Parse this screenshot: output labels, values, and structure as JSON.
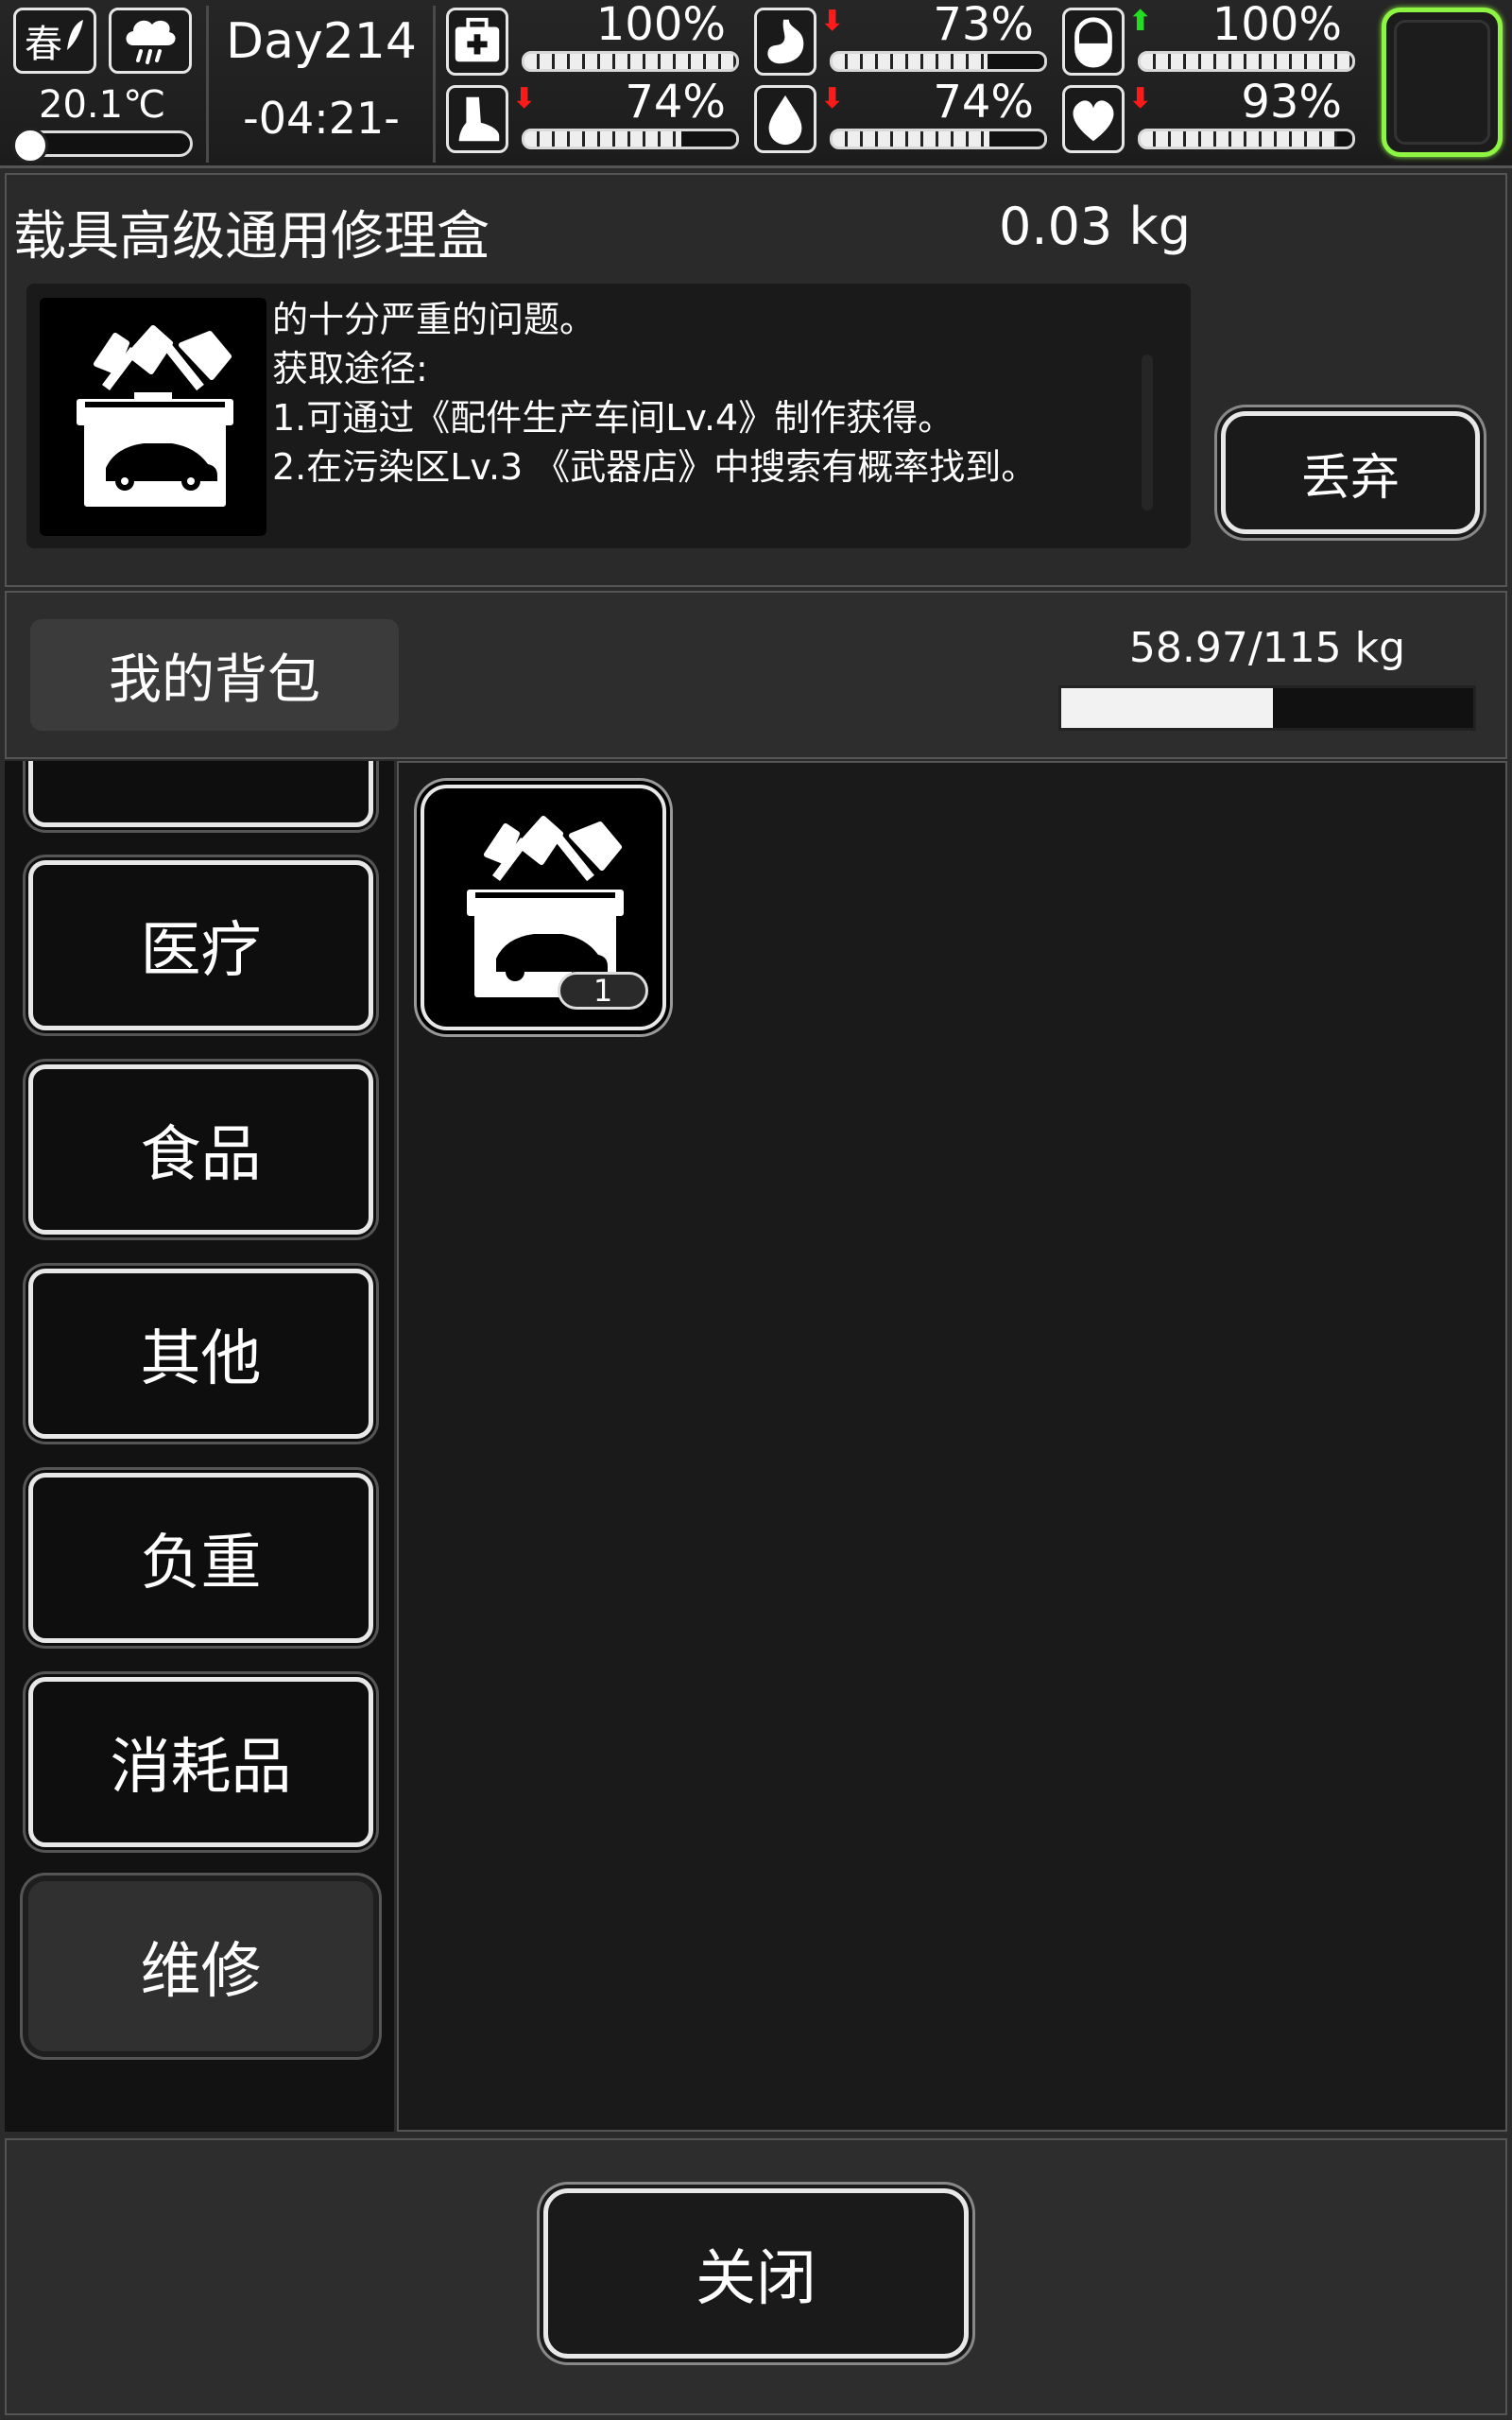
{
  "status": {
    "season": "春",
    "temperature": "20.1℃",
    "temperature_level": 0.15,
    "day": "Day214",
    "time": "-04:21-",
    "stats": [
      {
        "name": "health",
        "icon": "medkit-icon",
        "value": "100%",
        "fraction": 1.0,
        "trend": "none"
      },
      {
        "name": "hunger",
        "icon": "stomach-icon",
        "value": "73%",
        "fraction": 0.73,
        "trend": "down"
      },
      {
        "name": "immunity",
        "icon": "pill-icon",
        "value": "100%",
        "fraction": 1.0,
        "trend": "up"
      },
      {
        "name": "stamina",
        "icon": "foot-icon",
        "value": "74%",
        "fraction": 0.74,
        "trend": "down"
      },
      {
        "name": "thirst",
        "icon": "water-drop-icon",
        "value": "74%",
        "fraction": 0.74,
        "trend": "down"
      },
      {
        "name": "mood",
        "icon": "heart-icon",
        "value": "93%",
        "fraction": 0.93,
        "trend": "down"
      }
    ],
    "colors": {
      "down": "#ff1a1a",
      "up": "#22dd22",
      "slot_glow": "#8ef542"
    }
  },
  "item": {
    "name": "载具高级通用修理盒",
    "weight": "0.03 kg",
    "icon": "vehicle-repair-kit-icon",
    "description_lines": [
      "的十分严重的问题。",
      "获取途径:",
      "1.可通过《配件生产车间Lv.4》制作获得。",
      "2.在污染区Lv.3 《武器店》中搜索有概率找到。"
    ],
    "discard_label": "丢弃"
  },
  "bag": {
    "title": "我的背包",
    "weight_text": "58.97/115 kg",
    "weight_fraction": 0.5128
  },
  "categories": [
    "医疗",
    "食品",
    "其他",
    "负重",
    "消耗品",
    "维修"
  ],
  "active_category": "维修",
  "slots": [
    {
      "icon": "vehicle-repair-kit-icon",
      "count": "1"
    }
  ],
  "close_label": "关闭"
}
